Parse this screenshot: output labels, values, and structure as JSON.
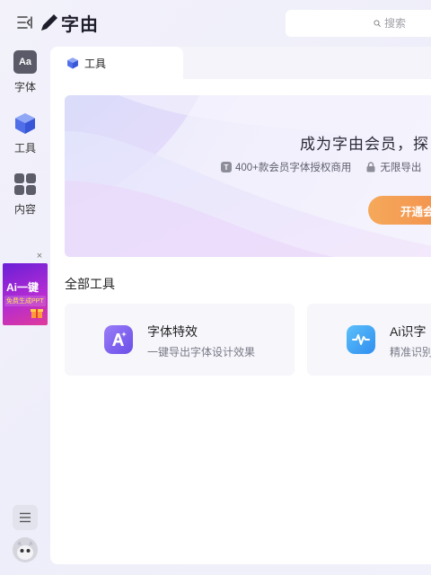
{
  "app": {
    "logo_text": "字由"
  },
  "search": {
    "placeholder": "搜索"
  },
  "nav": {
    "items": [
      {
        "label": "字体",
        "icon": "font-icon"
      },
      {
        "label": "工具",
        "icon": "cube-icon"
      },
      {
        "label": "内容",
        "icon": "grid-icon"
      }
    ]
  },
  "ad": {
    "title": "Ai一键",
    "subtitle": "免费生成PPT"
  },
  "tabs": [
    {
      "label": "工具",
      "icon": "cube-icon"
    }
  ],
  "banner": {
    "title": "成为字由会员，探",
    "features": [
      {
        "icon": "t-badge-icon",
        "text": "400+款会员字体授权商用"
      },
      {
        "icon": "lock-icon",
        "text": "无限导出"
      }
    ],
    "button_label": "开通会"
  },
  "section": {
    "title": "全部工具"
  },
  "tools": [
    {
      "title": "字体特效",
      "desc": "一键导出字体设计效果",
      "icon": "font-effect-icon",
      "color": "#7a5cf0"
    },
    {
      "title": "Ai识字",
      "desc": "精准识别",
      "icon": "waveform-icon",
      "color": "#2f9cf0"
    }
  ],
  "colors": {
    "accent": "#5b63e8",
    "button_orange": "#f28a4a",
    "background": "#f1f1fa"
  }
}
